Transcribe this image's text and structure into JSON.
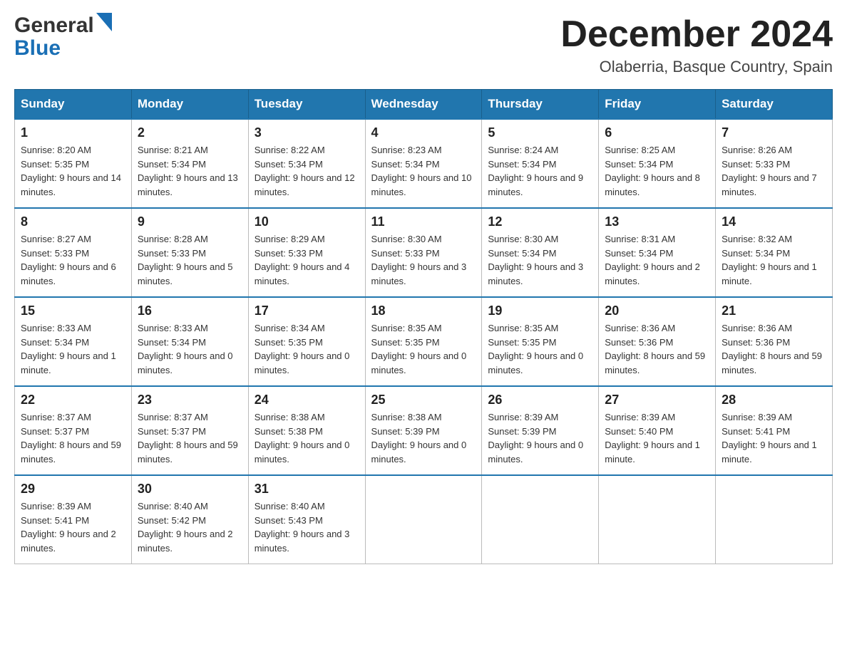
{
  "header": {
    "logo_general": "General",
    "logo_blue": "Blue",
    "title": "December 2024",
    "subtitle": "Olaberria, Basque Country, Spain"
  },
  "days": [
    "Sunday",
    "Monday",
    "Tuesday",
    "Wednesday",
    "Thursday",
    "Friday",
    "Saturday"
  ],
  "weeks": [
    [
      {
        "day": "1",
        "sunrise": "8:20 AM",
        "sunset": "5:35 PM",
        "daylight": "9 hours and 14 minutes."
      },
      {
        "day": "2",
        "sunrise": "8:21 AM",
        "sunset": "5:34 PM",
        "daylight": "9 hours and 13 minutes."
      },
      {
        "day": "3",
        "sunrise": "8:22 AM",
        "sunset": "5:34 PM",
        "daylight": "9 hours and 12 minutes."
      },
      {
        "day": "4",
        "sunrise": "8:23 AM",
        "sunset": "5:34 PM",
        "daylight": "9 hours and 10 minutes."
      },
      {
        "day": "5",
        "sunrise": "8:24 AM",
        "sunset": "5:34 PM",
        "daylight": "9 hours and 9 minutes."
      },
      {
        "day": "6",
        "sunrise": "8:25 AM",
        "sunset": "5:34 PM",
        "daylight": "9 hours and 8 minutes."
      },
      {
        "day": "7",
        "sunrise": "8:26 AM",
        "sunset": "5:33 PM",
        "daylight": "9 hours and 7 minutes."
      }
    ],
    [
      {
        "day": "8",
        "sunrise": "8:27 AM",
        "sunset": "5:33 PM",
        "daylight": "9 hours and 6 minutes."
      },
      {
        "day": "9",
        "sunrise": "8:28 AM",
        "sunset": "5:33 PM",
        "daylight": "9 hours and 5 minutes."
      },
      {
        "day": "10",
        "sunrise": "8:29 AM",
        "sunset": "5:33 PM",
        "daylight": "9 hours and 4 minutes."
      },
      {
        "day": "11",
        "sunrise": "8:30 AM",
        "sunset": "5:33 PM",
        "daylight": "9 hours and 3 minutes."
      },
      {
        "day": "12",
        "sunrise": "8:30 AM",
        "sunset": "5:34 PM",
        "daylight": "9 hours and 3 minutes."
      },
      {
        "day": "13",
        "sunrise": "8:31 AM",
        "sunset": "5:34 PM",
        "daylight": "9 hours and 2 minutes."
      },
      {
        "day": "14",
        "sunrise": "8:32 AM",
        "sunset": "5:34 PM",
        "daylight": "9 hours and 1 minute."
      }
    ],
    [
      {
        "day": "15",
        "sunrise": "8:33 AM",
        "sunset": "5:34 PM",
        "daylight": "9 hours and 1 minute."
      },
      {
        "day": "16",
        "sunrise": "8:33 AM",
        "sunset": "5:34 PM",
        "daylight": "9 hours and 0 minutes."
      },
      {
        "day": "17",
        "sunrise": "8:34 AM",
        "sunset": "5:35 PM",
        "daylight": "9 hours and 0 minutes."
      },
      {
        "day": "18",
        "sunrise": "8:35 AM",
        "sunset": "5:35 PM",
        "daylight": "9 hours and 0 minutes."
      },
      {
        "day": "19",
        "sunrise": "8:35 AM",
        "sunset": "5:35 PM",
        "daylight": "9 hours and 0 minutes."
      },
      {
        "day": "20",
        "sunrise": "8:36 AM",
        "sunset": "5:36 PM",
        "daylight": "8 hours and 59 minutes."
      },
      {
        "day": "21",
        "sunrise": "8:36 AM",
        "sunset": "5:36 PM",
        "daylight": "8 hours and 59 minutes."
      }
    ],
    [
      {
        "day": "22",
        "sunrise": "8:37 AM",
        "sunset": "5:37 PM",
        "daylight": "8 hours and 59 minutes."
      },
      {
        "day": "23",
        "sunrise": "8:37 AM",
        "sunset": "5:37 PM",
        "daylight": "8 hours and 59 minutes."
      },
      {
        "day": "24",
        "sunrise": "8:38 AM",
        "sunset": "5:38 PM",
        "daylight": "9 hours and 0 minutes."
      },
      {
        "day": "25",
        "sunrise": "8:38 AM",
        "sunset": "5:39 PM",
        "daylight": "9 hours and 0 minutes."
      },
      {
        "day": "26",
        "sunrise": "8:39 AM",
        "sunset": "5:39 PM",
        "daylight": "9 hours and 0 minutes."
      },
      {
        "day": "27",
        "sunrise": "8:39 AM",
        "sunset": "5:40 PM",
        "daylight": "9 hours and 1 minute."
      },
      {
        "day": "28",
        "sunrise": "8:39 AM",
        "sunset": "5:41 PM",
        "daylight": "9 hours and 1 minute."
      }
    ],
    [
      {
        "day": "29",
        "sunrise": "8:39 AM",
        "sunset": "5:41 PM",
        "daylight": "9 hours and 2 minutes."
      },
      {
        "day": "30",
        "sunrise": "8:40 AM",
        "sunset": "5:42 PM",
        "daylight": "9 hours and 2 minutes."
      },
      {
        "day": "31",
        "sunrise": "8:40 AM",
        "sunset": "5:43 PM",
        "daylight": "9 hours and 3 minutes."
      },
      null,
      null,
      null,
      null
    ]
  ]
}
